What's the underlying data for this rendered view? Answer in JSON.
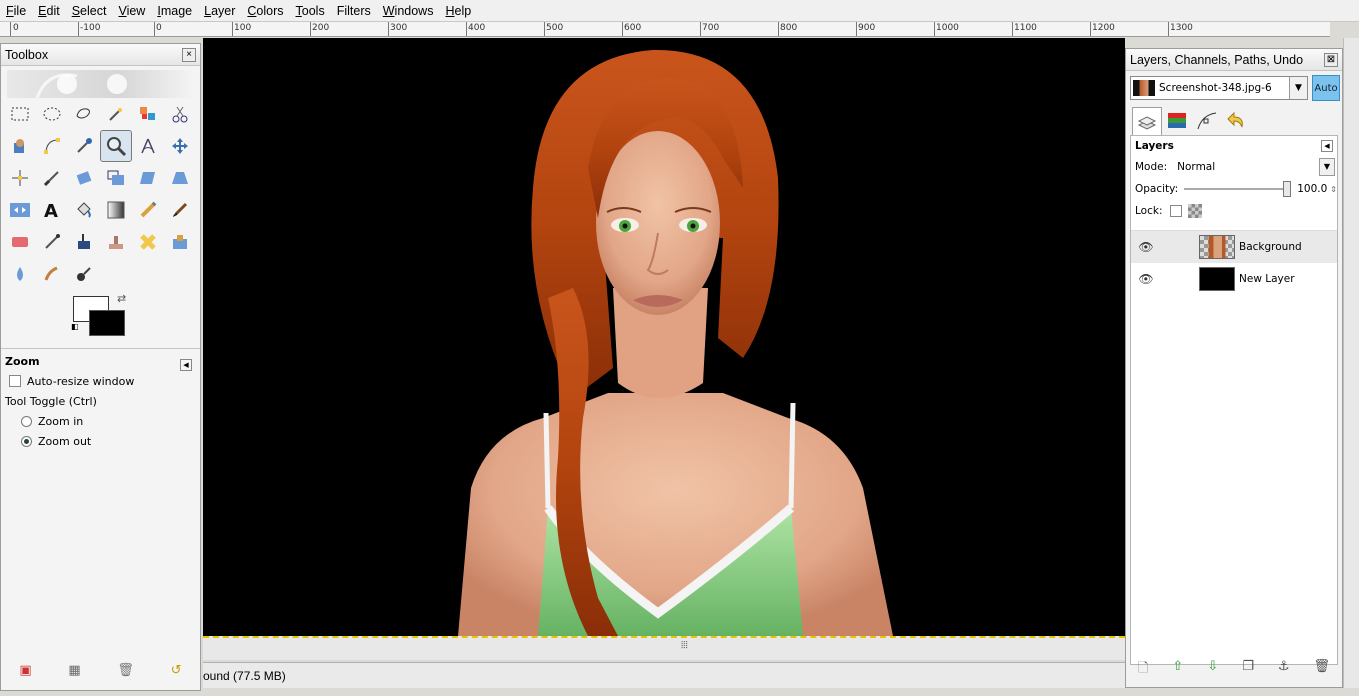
{
  "menubar": {
    "items": [
      {
        "label": "File",
        "key": "F",
        "rest": "ile"
      },
      {
        "label": "Edit",
        "key": "E",
        "rest": "dit"
      },
      {
        "label": "Select",
        "key": "S",
        "rest": "elect"
      },
      {
        "label": "View",
        "key": "V",
        "rest": "iew"
      },
      {
        "label": "Image",
        "key": "I",
        "rest": "mage"
      },
      {
        "label": "Layer",
        "key": "L",
        "rest": "ayer"
      },
      {
        "label": "Colors",
        "key": "C",
        "rest": "olors"
      },
      {
        "label": "Tools",
        "key": "T",
        "rest": "ools"
      },
      {
        "label": "Filters",
        "key": "",
        "rest": "Filters",
        "ulIndex": 4
      },
      {
        "label": "Windows",
        "key": "W",
        "rest": "indows"
      },
      {
        "label": "Help",
        "key": "H",
        "rest": "elp"
      }
    ]
  },
  "ruler": {
    "labels": [
      "0",
      "-100",
      "0",
      "100",
      "200",
      "300",
      "400",
      "500",
      "600",
      "700",
      "800",
      "900",
      "1000",
      "1100",
      "1200",
      "1300"
    ]
  },
  "toolbox": {
    "title": "Toolbox",
    "close": "×",
    "tool_options": {
      "title": "Zoom",
      "auto_resize": "Auto-resize window",
      "toggle_label": "Tool Toggle  (Ctrl)",
      "zoom_in": "Zoom in",
      "zoom_out": "Zoom out"
    }
  },
  "status": {
    "text": "ound (77.5 MB)"
  },
  "layers_dock": {
    "title": "Layers, Channels, Paths, Undo",
    "close": "⊠",
    "image_name": "Screenshot-348.jpg-6",
    "auto": "Auto",
    "panel_title": "Layers",
    "mode_label": "Mode:",
    "mode_value": "Normal",
    "opacity_label": "Opacity:",
    "opacity_value": "100.0",
    "opacity_fraction": 1.0,
    "lock_label": "Lock:",
    "layers": [
      {
        "name": "Background",
        "selected": true
      },
      {
        "name": "New Layer",
        "selected": false
      }
    ]
  },
  "colors": {
    "accent": "#7bc2ec",
    "fg": "#ffffff",
    "bg": "#000000"
  }
}
